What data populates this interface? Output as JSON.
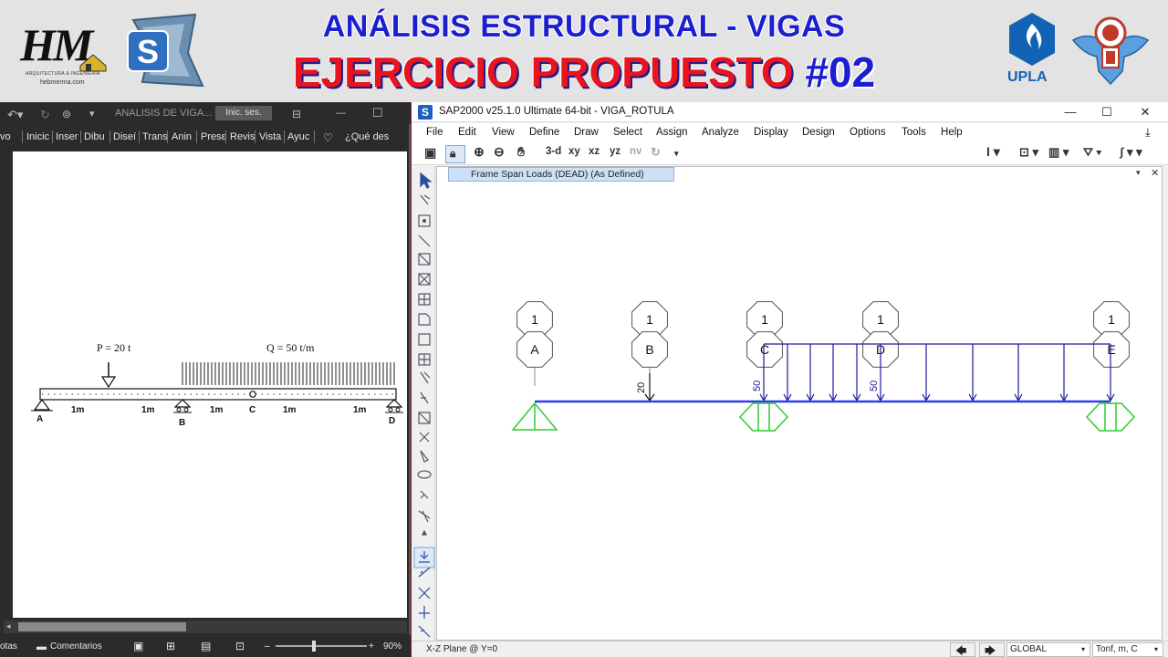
{
  "banner": {
    "title_line1": "ANÁLISIS ESTRUCTURAL - VIGAS",
    "title_line2_red": "EJERCICIO PROPUESTO",
    "title_line2_num": "#02",
    "hm_logo": {
      "mark": "HM",
      "subtitle": "ARQUITECTURA & INGENIERÍA",
      "url": "hebmerma.com"
    },
    "upla_logo": {
      "text": "UPLA"
    },
    "colors": {
      "title1": "#1b1fcf",
      "title2": "#e8141e",
      "background": "#e3e3e3"
    }
  },
  "word": {
    "doc_title": "ANALISIS DE VIGA...",
    "signin": "Inic. ses.",
    "ribbon_tabs": [
      "vo",
      "Inicic",
      "Inser",
      "Dibu",
      "Diseí",
      "Trans",
      "Anin",
      "Presε",
      "Revis",
      "Vista",
      "Ayuc"
    ],
    "tell_me": "¿Qué des",
    "status": {
      "left": "otas",
      "comments": "Comentarios",
      "zoom": "90%"
    },
    "figure": {
      "load_p": "P = 20 t",
      "load_q": "Q = 50 t/m",
      "points": [
        "A",
        "B",
        "C",
        "D"
      ],
      "spans": [
        "1m",
        "1m",
        "1m",
        "1m",
        "1m"
      ]
    }
  },
  "sap": {
    "window_title": "SAP2000 v25.1.0 Ultimate 64-bit - VIGA_ROTULA",
    "menu": [
      "File",
      "Edit",
      "View",
      "Define",
      "Draw",
      "Select",
      "Assign",
      "Analyze",
      "Display",
      "Design",
      "Options",
      "Tools",
      "Help"
    ],
    "toolbar_views": [
      "3-d",
      "xy",
      "xz",
      "yz",
      "nv"
    ],
    "panel_tab": "Frame Span Loads (DEAD) (As Defined)",
    "grid_numbers": [
      "1",
      "1",
      "1",
      "1",
      "1"
    ],
    "grid_letters": [
      "A",
      "B",
      "C",
      "D",
      "E"
    ],
    "point_load_label": "20",
    "dist_load_labels": [
      "50",
      "50"
    ],
    "status": {
      "plane": "X-Z Plane @ Y=0",
      "coord_system": "GLOBAL",
      "units": "Tonf, m, C"
    },
    "colors": {
      "beam": "#2b3ff0",
      "load": "#1a1a9e",
      "support": "#2ecc2e"
    }
  }
}
